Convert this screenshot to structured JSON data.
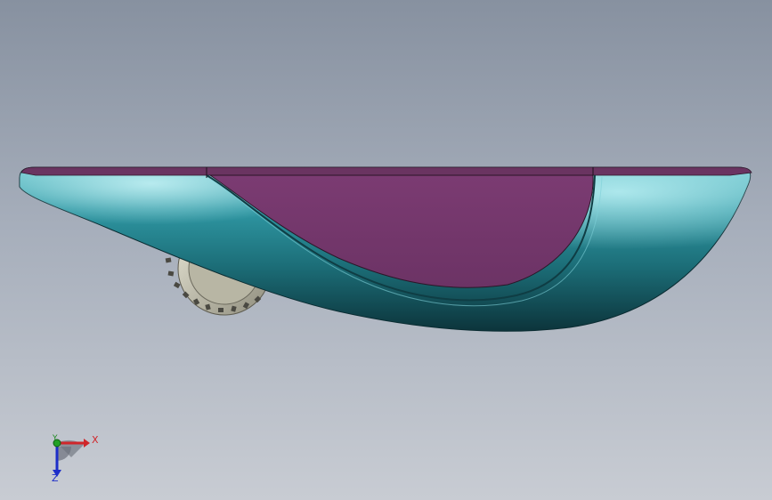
{
  "viewport": {
    "background_top": "#8791a0",
    "background_bottom": "#c8ccd3"
  },
  "model": {
    "icon": "3d-part-model",
    "colors": {
      "body": "#1f7f8c",
      "body_highlight": "#8fd9e0",
      "body_shadow": "#0e3a42",
      "inner_face": "#763a6d",
      "gear": "#c9c7b4"
    }
  },
  "triad": {
    "icon": "coordinate-triad-icon",
    "x_label": "X",
    "y_label": "Y",
    "z_label": "Z",
    "colors": {
      "x": "#d0262a",
      "y": "#1f8a22",
      "z": "#1d2ec9"
    }
  }
}
